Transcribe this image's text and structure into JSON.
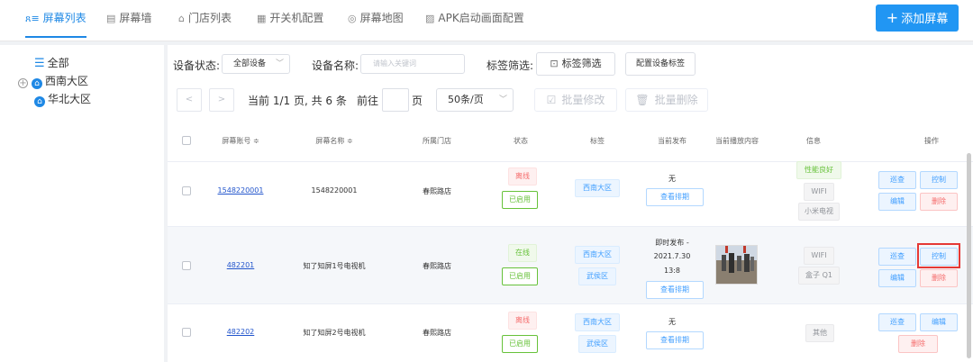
{
  "nav": {
    "tabs": [
      {
        "label": "屏幕列表",
        "icon": "user-list-icon",
        "glyph": "ጸ≡"
      },
      {
        "label": "屏幕墙",
        "icon": "screen-wall-icon",
        "glyph": "▤"
      },
      {
        "label": "门店列表",
        "icon": "store-icon",
        "glyph": "⌂"
      },
      {
        "label": "开关机配置",
        "icon": "calendar-icon",
        "glyph": "▦"
      },
      {
        "label": "屏幕地图",
        "icon": "location-icon",
        "glyph": "◎"
      },
      {
        "label": "APK启动画面配置",
        "icon": "image-icon",
        "glyph": "▨"
      }
    ],
    "add_button": "添加屏幕",
    "accent": "#1e88e5"
  },
  "tree": {
    "items": [
      {
        "label": "全部"
      },
      {
        "label": "西南大区"
      },
      {
        "label": "华北大区"
      }
    ]
  },
  "filters": {
    "status_label": "设备状态:",
    "status_value": "全部设备",
    "name_label": "设备名称:",
    "name_placeholder": "请输入关键词",
    "tag_label": "标签筛选:",
    "tag_button": "标签筛选",
    "config_button": "配置设备标签"
  },
  "pager": {
    "prev": "<",
    "next": ">",
    "info": "当前 1/1 页, 共 6 条",
    "goto_prefix": "前往",
    "goto_suffix": "页",
    "page_size": "50条/页",
    "batch_edit": "批量修改",
    "batch_delete": "批量删除"
  },
  "table": {
    "headers": [
      "屏幕账号 ≑",
      "屏幕名称 ≑",
      "所属门店",
      "状态",
      "标签",
      "当前发布",
      "当前播放内容",
      "信息",
      "操作"
    ],
    "rows": [
      {
        "account": "1548220001",
        "name": "1548220001",
        "store": "春熙路店",
        "status": "离线",
        "enabled": "已启用",
        "tags": [
          "西南大区"
        ],
        "publish": "无",
        "publish_btn": "查看排期",
        "info": [
          "性能良好",
          "WIFI",
          "小米电视"
        ],
        "actions": [
          "巡查",
          "控制",
          "编辑",
          "删除"
        ]
      },
      {
        "account": "482201",
        "name": "知了知屏1号电视机",
        "store": "春熙路店",
        "status": "在线",
        "enabled": "已启用",
        "tags": [
          "西南大区",
          "武侯区"
        ],
        "publish": [
          "即时发布 -",
          "2021.7.30",
          "13:8"
        ],
        "publish_btn": "查看排期",
        "info": [
          "WIFI",
          "盒子 Q1"
        ],
        "actions": [
          "巡查",
          "控制",
          "编辑",
          "删除"
        ]
      },
      {
        "account": "482202",
        "name": "知了知屏2号电视机",
        "store": "春熙路店",
        "status": "离线",
        "enabled": "已启用",
        "tags": [
          "西南大区",
          "武侯区"
        ],
        "publish": "无",
        "publish_btn": "查看排期",
        "info": [
          "其他"
        ],
        "actions": [
          "巡查",
          "编辑",
          "删除"
        ]
      }
    ]
  }
}
